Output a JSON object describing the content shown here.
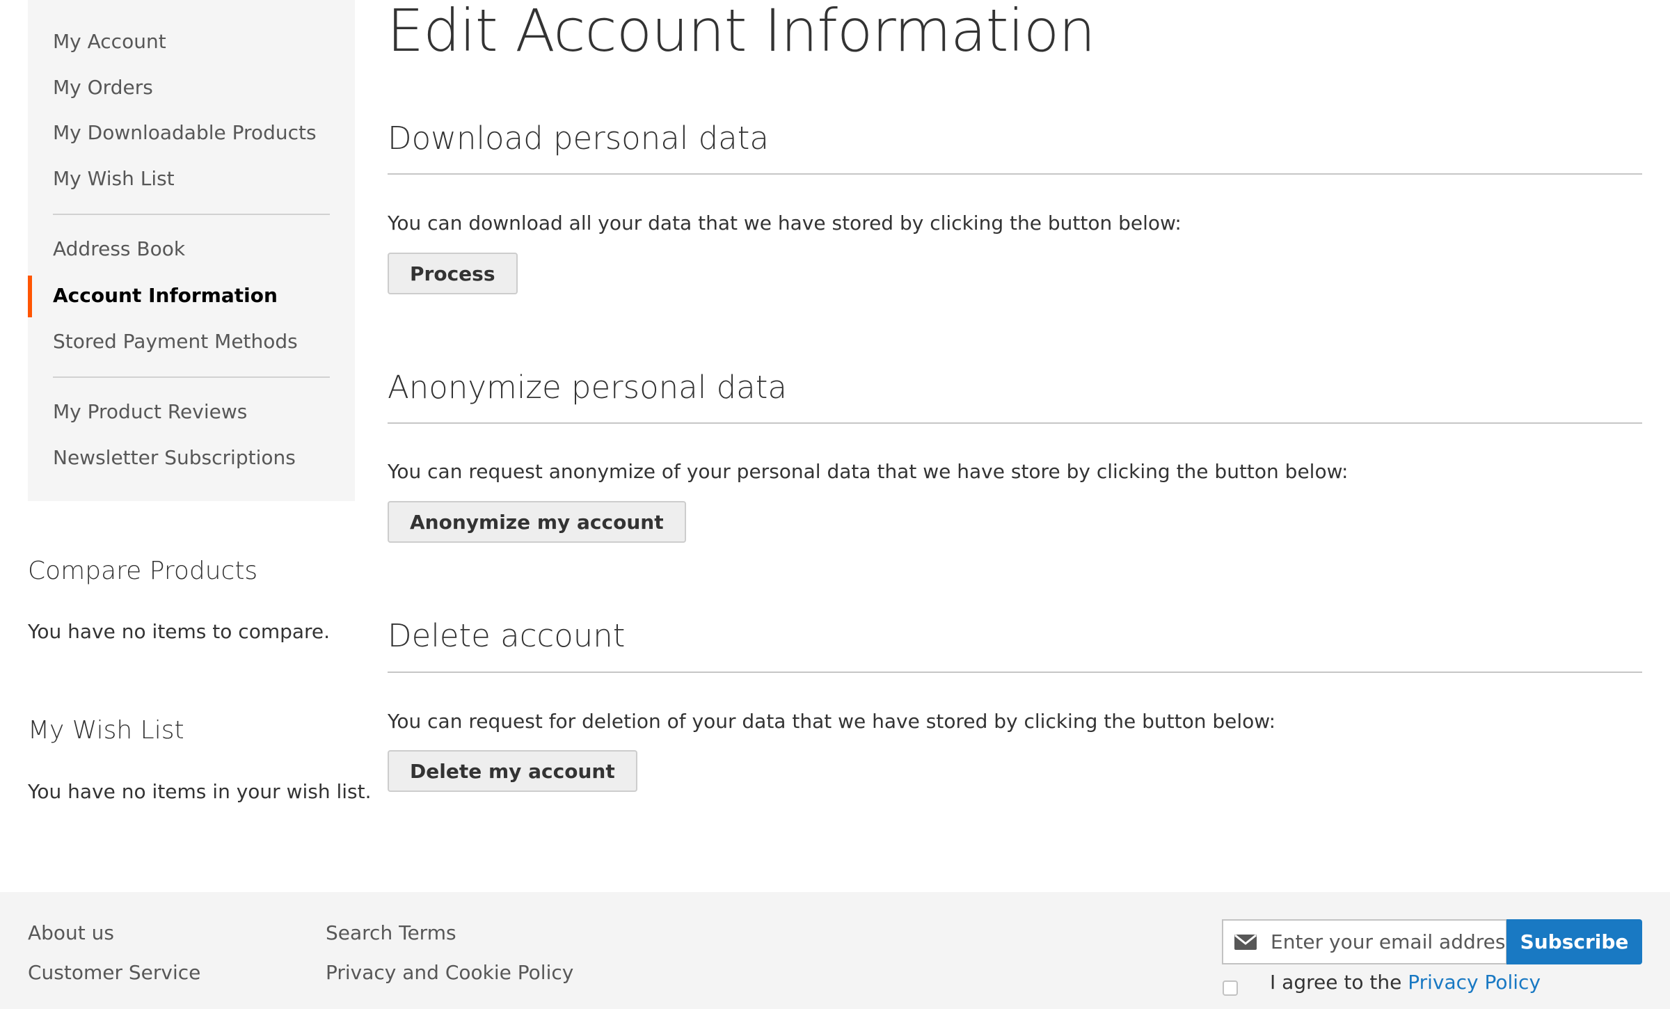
{
  "sidebar": {
    "nav_items": [
      {
        "label": "My Account",
        "active": false
      },
      {
        "label": "My Orders",
        "active": false
      },
      {
        "label": "My Downloadable Products",
        "active": false
      },
      {
        "label": "My Wish List",
        "active": false
      },
      {
        "label": "Address Book",
        "active": false
      },
      {
        "label": "Account Information",
        "active": true
      },
      {
        "label": "Stored Payment Methods",
        "active": false
      },
      {
        "label": "My Product Reviews",
        "active": false
      },
      {
        "label": "Newsletter Subscriptions",
        "active": false
      }
    ],
    "active_color": "#ff5501",
    "compare": {
      "title": "Compare Products",
      "text": "You have no items to compare."
    },
    "wishlist": {
      "title": "My Wish List",
      "text": "You have no items in your wish list."
    }
  },
  "main": {
    "title": "Edit Account Information",
    "sections": [
      {
        "title": "Download personal data",
        "text": "You can download all your data that we have stored by clicking the button below:",
        "button": "Process"
      },
      {
        "title": "Anonymize personal data",
        "text": "You can request anonymize of your personal data that we have store by clicking the button below:",
        "button": "Anonymize my account"
      },
      {
        "title": "Delete account",
        "text": "You can request for deletion of your data that we have stored by clicking the button below:",
        "button": "Delete my account"
      }
    ]
  },
  "footer": {
    "links_col1": [
      "About us",
      "Customer Service"
    ],
    "links_col2": [
      "Search Terms",
      "Privacy and Cookie Policy"
    ],
    "newsletter": {
      "placeholder": "Enter your email address",
      "value": "",
      "icon": "envelope-icon",
      "subscribe_label": "Subscribe",
      "agree_prefix": "I agree to the ",
      "agree_link": "Privacy Policy",
      "agree_checked": false
    },
    "accent_color": "#1979c3"
  }
}
